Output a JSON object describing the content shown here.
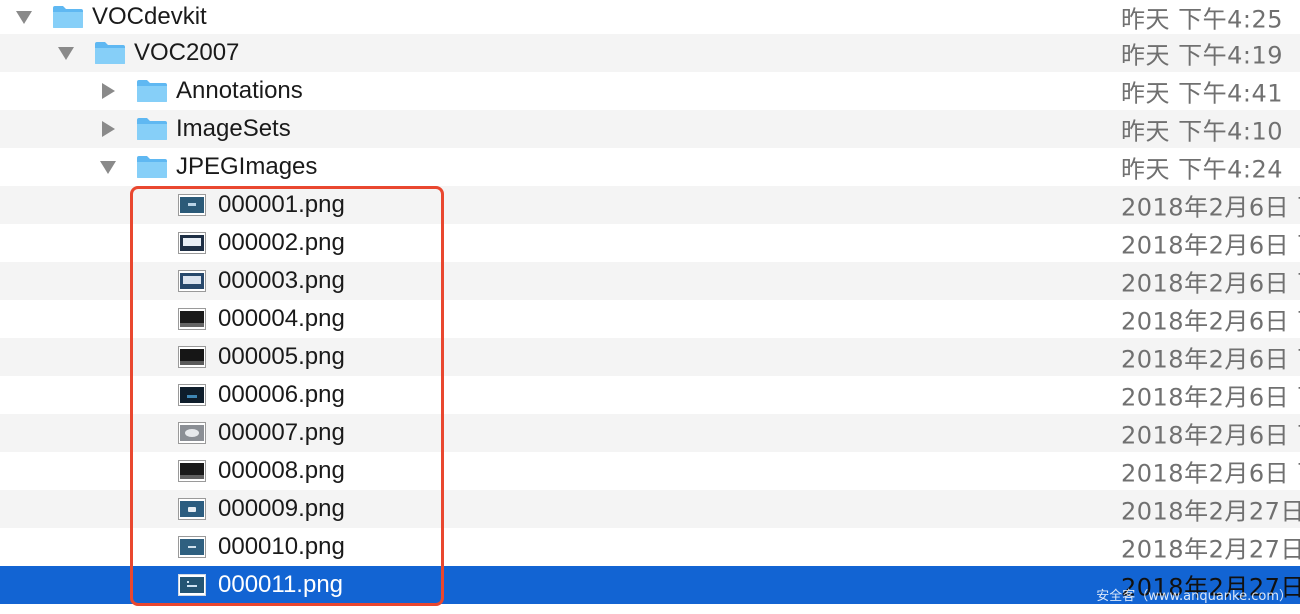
{
  "tree": {
    "rows": [
      {
        "name": "VOCdevkit",
        "date": "昨天 下午4:25",
        "type": "folder",
        "expanded": true
      },
      {
        "name": "VOC2007",
        "date": "昨天 下午4:19",
        "type": "folder",
        "expanded": true
      },
      {
        "name": "Annotations",
        "date": "昨天 下午4:41",
        "type": "folder",
        "expanded": false
      },
      {
        "name": "ImageSets",
        "date": "昨天 下午4:10",
        "type": "folder",
        "expanded": false
      },
      {
        "name": "JPEGImages",
        "date": "昨天 下午4:24",
        "type": "folder",
        "expanded": true
      },
      {
        "name": "000001.png",
        "date": "2018年2月6日 下",
        "type": "file"
      },
      {
        "name": "000002.png",
        "date": "2018年2月6日 下",
        "type": "file"
      },
      {
        "name": "000003.png",
        "date": "2018年2月6日 下",
        "type": "file"
      },
      {
        "name": "000004.png",
        "date": "2018年2月6日 下",
        "type": "file"
      },
      {
        "name": "000005.png",
        "date": "2018年2月6日 下",
        "type": "file"
      },
      {
        "name": "000006.png",
        "date": "2018年2月6日 下",
        "type": "file"
      },
      {
        "name": "000007.png",
        "date": "2018年2月6日 下",
        "type": "file"
      },
      {
        "name": "000008.png",
        "date": "2018年2月6日 下",
        "type": "file"
      },
      {
        "name": "000009.png",
        "date": "2018年2月27日",
        "type": "file"
      },
      {
        "name": "000010.png",
        "date": "2018年2月27日",
        "type": "file"
      },
      {
        "name": "000011.png",
        "date": "2018年2月27日",
        "type": "file",
        "selected": true
      }
    ]
  },
  "watermark": "安全客（www.anquanke.com）",
  "colors": {
    "selection": "#1264d3",
    "folder": "#6cc0f5",
    "highlight_box": "#e9472f",
    "alt_row": "#f4f4f4"
  }
}
